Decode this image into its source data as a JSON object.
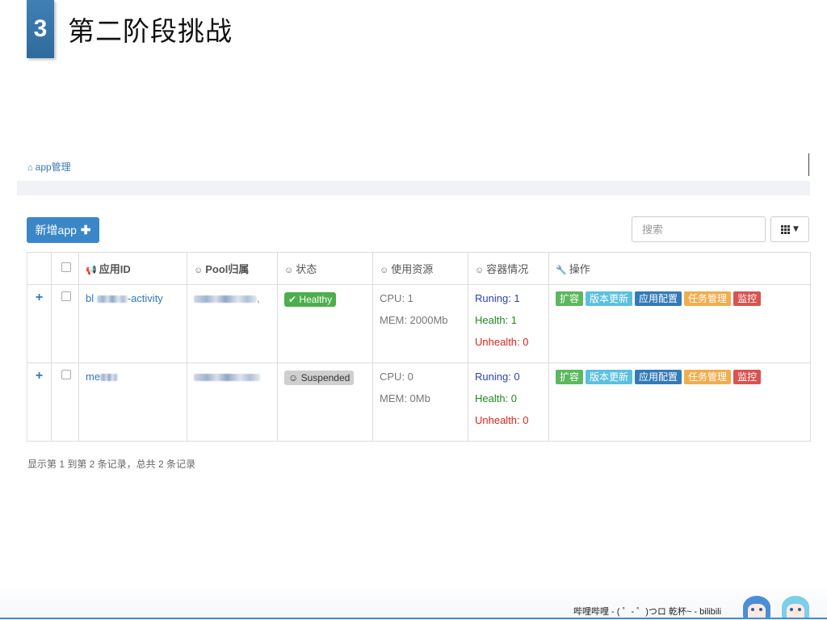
{
  "slide": {
    "number": "3",
    "title": "第二阶段挑战"
  },
  "breadcrumb": {
    "home_icon": "home-icon",
    "label": "app管理"
  },
  "toolbar": {
    "add_label": "新增app",
    "add_icon": "plus-icon",
    "search_placeholder": "搜索",
    "columns_icon": "grid-icon"
  },
  "table": {
    "headers": {
      "id": "应用ID",
      "pool": "Pool归属",
      "status": "状态",
      "resources": "使用资源",
      "containers": "容器情况",
      "actions": "操作"
    },
    "header_icons": {
      "id": "bullhorn-icon",
      "pool": "smile-icon",
      "status": "smile-icon",
      "resources": "smile-icon",
      "containers": "smile-icon",
      "actions": "wrench-icon"
    },
    "rows": [
      {
        "id_prefix": "bl",
        "id_suffix": "-activity",
        "pool_tail": ",",
        "status": "Healthy",
        "cpu": "CPU: 1",
        "mem": "MEM: 2000Mb",
        "running": "Runing: 1",
        "health": "Health: 1",
        "unhealth": "Unhealth: 0"
      },
      {
        "id_prefix": "me",
        "id_suffix": "",
        "pool_tail": "",
        "status": "Suspended",
        "cpu": "CPU: 0",
        "mem": "MEM: 0Mb",
        "running": "Runing: 0",
        "health": "Health: 0",
        "unhealth": "Unhealth: 0"
      }
    ],
    "actions": [
      "扩容",
      "版本更新",
      "应用配置",
      "任务管理",
      "监控"
    ]
  },
  "summary": "显示第 1 到第 2 条记录，总共 2 条记录",
  "footer": {
    "text": "哔哩哔哩 - ( ゜- ゜)つロ 乾杯~ - bilibili"
  },
  "colors": {
    "primary": "#3a87c8",
    "healthy": "#4cae4c",
    "running": "#2b42b8",
    "health": "#1f8a1f",
    "unhealth": "#d9261c"
  }
}
